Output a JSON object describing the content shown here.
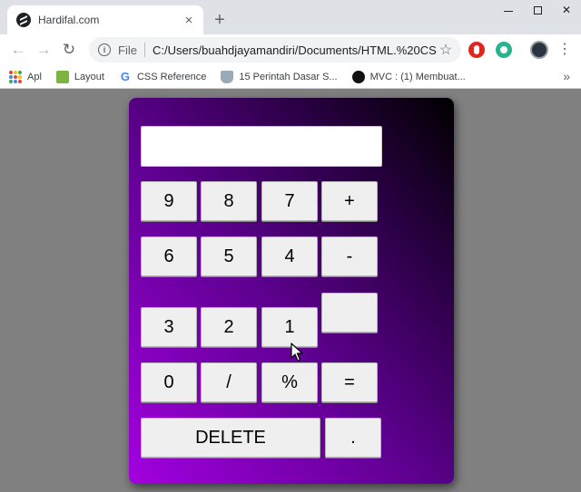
{
  "browser": {
    "tab_title": "Hardifal.com",
    "tab_close": "×",
    "new_tab": "+",
    "url_scheme": "File",
    "url": "C:/Users/buahdjayamandiri/Documents/HTML.%20CS...",
    "bookmarks": [
      {
        "label": "Apl",
        "icon": "apps-grid-icon"
      },
      {
        "label": "Layout",
        "icon": "layout-icon"
      },
      {
        "label": "CSS Reference",
        "icon": "google-icon"
      },
      {
        "label": "15 Perintah Dasar S...",
        "icon": "boat-icon"
      },
      {
        "label": "MVC : (1) Membuat...",
        "icon": "mvc-icon"
      }
    ],
    "bookmarks_more": "»"
  },
  "calculator": {
    "display_value": "",
    "keys": [
      [
        "9",
        "8",
        "7",
        "+"
      ],
      [
        "6",
        "5",
        "4",
        "-"
      ],
      [
        "3",
        "2",
        "1",
        ""
      ],
      [
        "0",
        "/",
        "%",
        "="
      ]
    ],
    "delete_label": "DELETE",
    "dot_label": "."
  },
  "colors": {
    "gradient_start": "#a300e0",
    "gradient_end": "#000000",
    "page_background": "#808080"
  }
}
